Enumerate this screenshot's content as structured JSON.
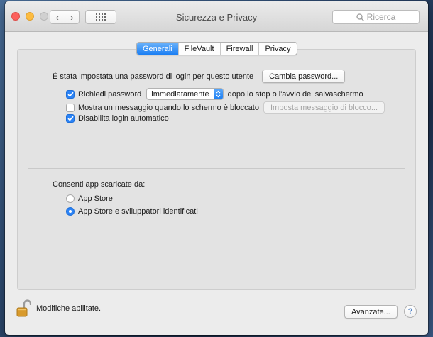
{
  "window": {
    "title": "Sicurezza e Privacy"
  },
  "toolbar": {
    "back_glyph": "‹",
    "forward_glyph": "›",
    "search_placeholder": "Ricerca",
    "search_glyph": "⚲"
  },
  "tabs": [
    {
      "label": "Generali",
      "active": true
    },
    {
      "label": "FileVault",
      "active": false
    },
    {
      "label": "Firewall",
      "active": false
    },
    {
      "label": "Privacy",
      "active": false
    }
  ],
  "general": {
    "password_text": "È stata impostata una password di login per questo utente",
    "change_password_button": "Cambia password...",
    "require_password": {
      "label": "Richiedi password",
      "checked": true,
      "select_value": "immediatamente",
      "suffix": "dopo lo stop o l'avvio del salvaschermo"
    },
    "show_message": {
      "label": "Mostra un messaggio quando lo schermo è bloccato",
      "checked": false,
      "button": "Imposta messaggio di blocco..."
    },
    "disable_autologin": {
      "label": "Disabilita login automatico",
      "checked": true
    }
  },
  "apps": {
    "heading": "Consenti app scaricate da:",
    "options": [
      {
        "label": "App Store",
        "selected": false
      },
      {
        "label": "App Store e sviluppatori identificati",
        "selected": true
      }
    ]
  },
  "footer": {
    "lock_text": "Modifiche abilitate.",
    "advanced_button": "Avanzate...",
    "help_glyph": "?"
  },
  "colors": {
    "accent": "#1b7ef3",
    "lock": "#d89a2c"
  }
}
